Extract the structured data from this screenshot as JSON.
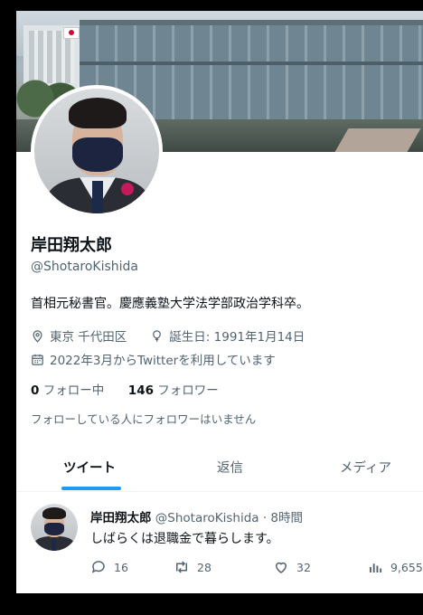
{
  "profile": {
    "name": "岸田翔太郎",
    "handle": "@ShotaroKishida",
    "bio": "首相元秘書官。慶應義塾大学法学部政治学科卒。",
    "location": "東京 千代田区",
    "birthday": "誕生日: 1991年1月14日",
    "joined": "2022年3月からTwitterを利用しています",
    "following_count": "0",
    "following_label": "フォロー中",
    "followers_count": "146",
    "followers_label": "フォロワー",
    "no_mutual_text": "フォローしている人にフォロワーはいません"
  },
  "tabs": [
    {
      "label": "ツイート",
      "active": true
    },
    {
      "label": "返信",
      "active": false
    },
    {
      "label": "メディア",
      "active": false
    }
  ],
  "tweet": {
    "author": "岸田翔太郎",
    "handle_time": "@ShotaroKishida · 8時間",
    "text": "しばらくは退職金で暮らします。",
    "replies": "16",
    "retweets": "28",
    "likes": "32",
    "views": "9,655"
  },
  "colors": {
    "accent": "#1d9bf0",
    "secondary_text": "#536471",
    "primary_text": "#0f1419"
  },
  "icons": [
    "location-icon",
    "birthday-balloon-icon",
    "calendar-icon",
    "reply-icon",
    "retweet-icon",
    "like-icon",
    "views-icon"
  ]
}
